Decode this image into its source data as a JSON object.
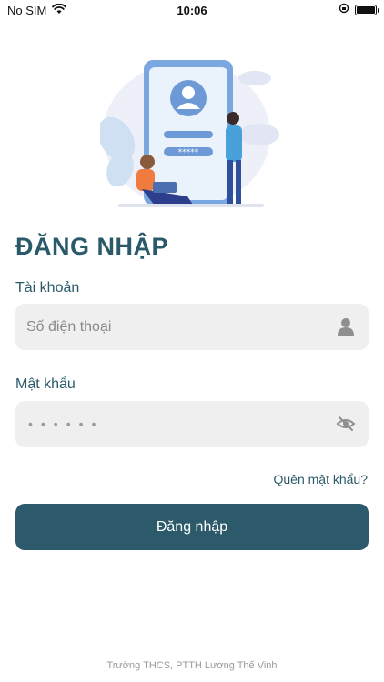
{
  "status_bar": {
    "carrier": "No SIM",
    "time": "10:06",
    "battery_level": 1.0,
    "icons": [
      "wifi-icon",
      "rotation-lock-icon",
      "battery-icon"
    ]
  },
  "hero": {
    "icon": "login-illustration"
  },
  "login": {
    "title": "ĐĂNG NHẬP",
    "username_label": "Tài khoản",
    "username_placeholder": "Số điện thoại",
    "username_value": "",
    "username_icon": "user-icon",
    "password_label": "Mật khẩu",
    "password_value": "••••••",
    "password_icon": "eye-slash-icon",
    "forgot_link": "Quên mật khẩu?",
    "submit_label": "Đăng nhập"
  },
  "footer": {
    "text": "Trường THCS, PTTH Lương Thế Vinh"
  },
  "colors": {
    "primary": "#2c5a6b",
    "title": "#2a5a6a",
    "field_bg": "#efefef",
    "placeholder": "#8a8a8a"
  }
}
